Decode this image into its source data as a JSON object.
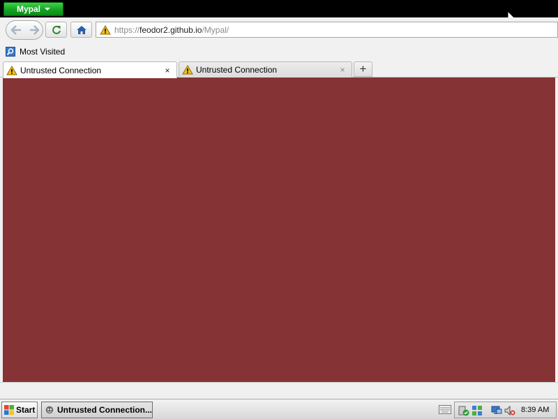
{
  "app": {
    "menu_label": "Mypal"
  },
  "nav": {
    "url_scheme": "https://",
    "url_host": "feodor2.github.io",
    "url_path": "/Mypal/"
  },
  "bookmarks": {
    "most_visited": "Most Visited"
  },
  "tabs": [
    {
      "label": "Untrusted Connection",
      "close": "×"
    },
    {
      "label": "Untrusted Connection",
      "close": "×"
    }
  ],
  "new_tab_label": "+",
  "colors": {
    "content_background": "#853334",
    "app_menu": "#15a322"
  },
  "taskbar": {
    "start_label": "Start",
    "task_label": "Untrusted Connection...",
    "clock": "8:39 AM"
  }
}
